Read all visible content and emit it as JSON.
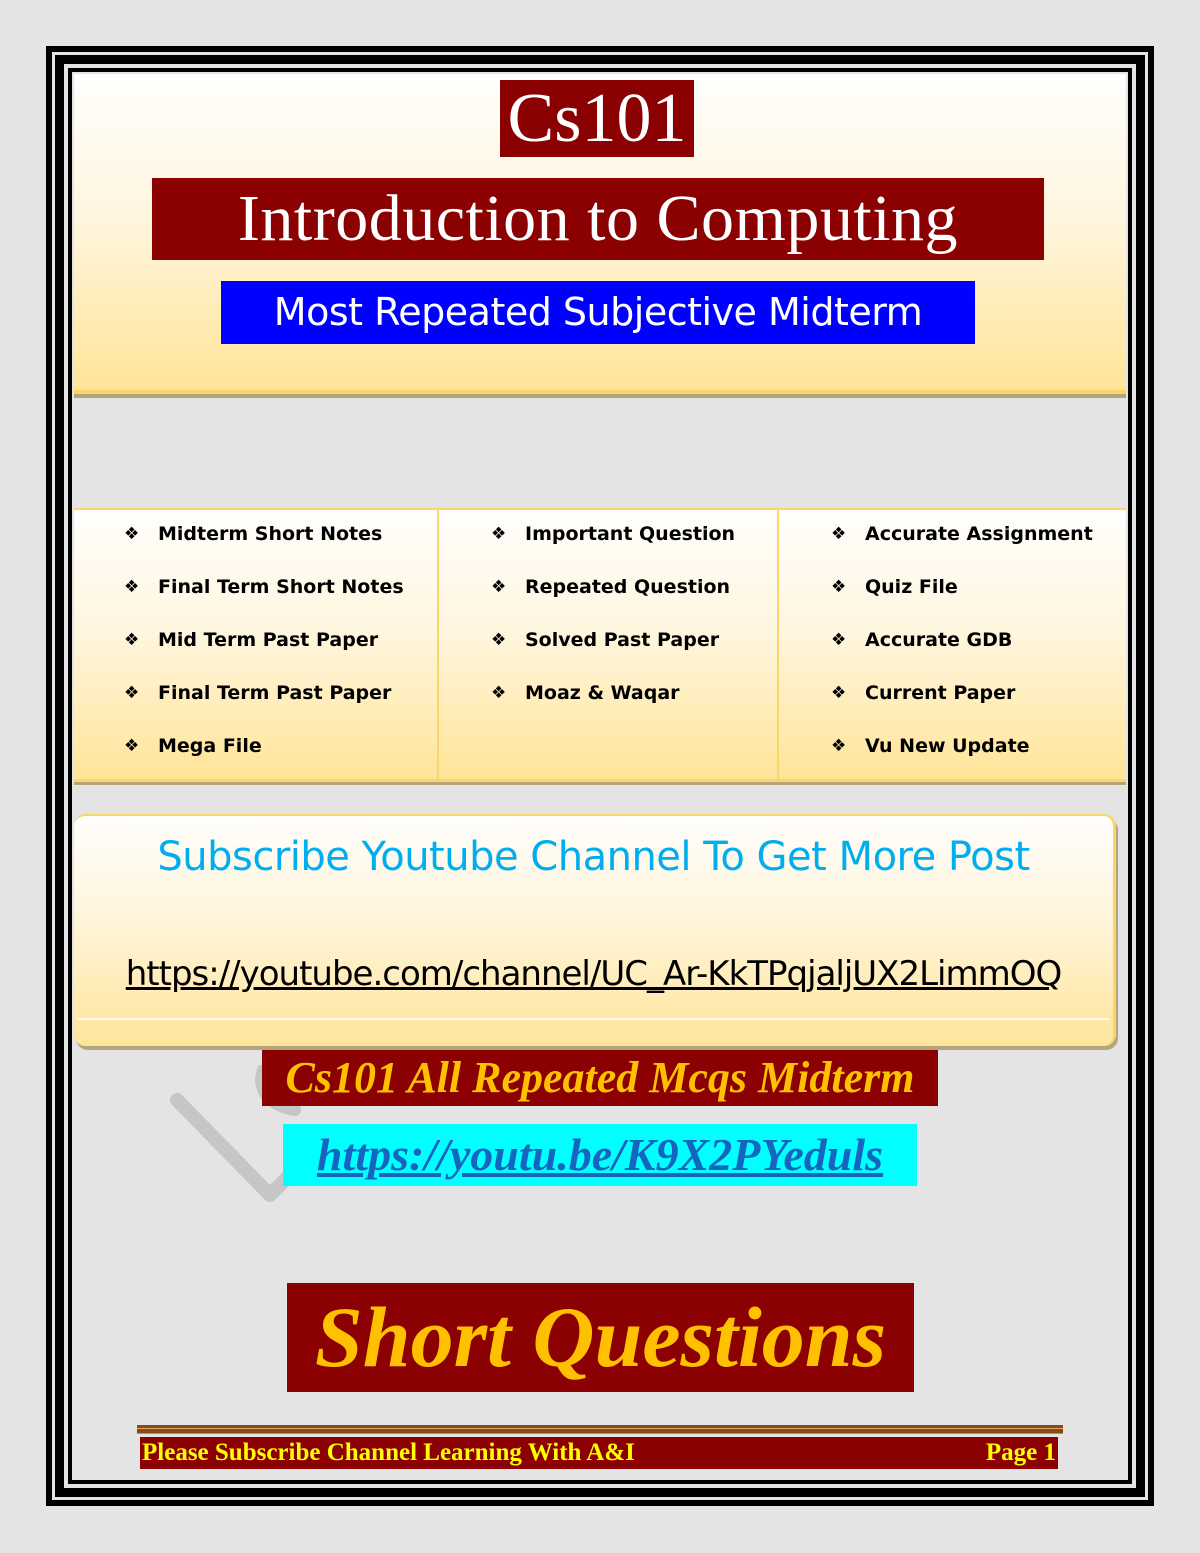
{
  "header": {
    "course_code": "Cs101",
    "course_name": "Introduction to Computing",
    "subtitle": "Most Repeated Subjective Midterm"
  },
  "resources": {
    "bullet_icon": "four-diamond-bullet",
    "columns": [
      {
        "items": [
          "Midterm Short Notes",
          "Final Term Short Notes",
          "Mid Term Past Paper",
          "Final Term Past Paper",
          "Mega File"
        ]
      },
      {
        "items": [
          "Important Question",
          "Repeated Question",
          "Solved Past Paper",
          "Moaz & Waqar"
        ]
      },
      {
        "items": [
          "Accurate Assignment",
          "Quiz File",
          "Accurate GDB",
          "Current Paper",
          "Vu New Update"
        ]
      }
    ]
  },
  "subscribe": {
    "title": "Subscribe Youtube Channel To Get More Post",
    "channel_url": "https://youtube.com/channel/UC_Ar-KkTPqjaljUX2LimmOQ"
  },
  "mcq": {
    "banner": "Cs101 All Repeated Mcqs Midterm",
    "link": "https://youtu.be/K9X2PYeduls"
  },
  "section_title": "Short Questions",
  "footer": {
    "left_text": "Please Subscribe Channel Learning With A&I",
    "page_label": "Page 1"
  },
  "colors": {
    "maroon": "#8b0000",
    "gold": "#ffc000",
    "blue": "#0000ff",
    "cyan": "#00ffff",
    "sky": "#00aeef",
    "footer_text": "#ffff00"
  }
}
